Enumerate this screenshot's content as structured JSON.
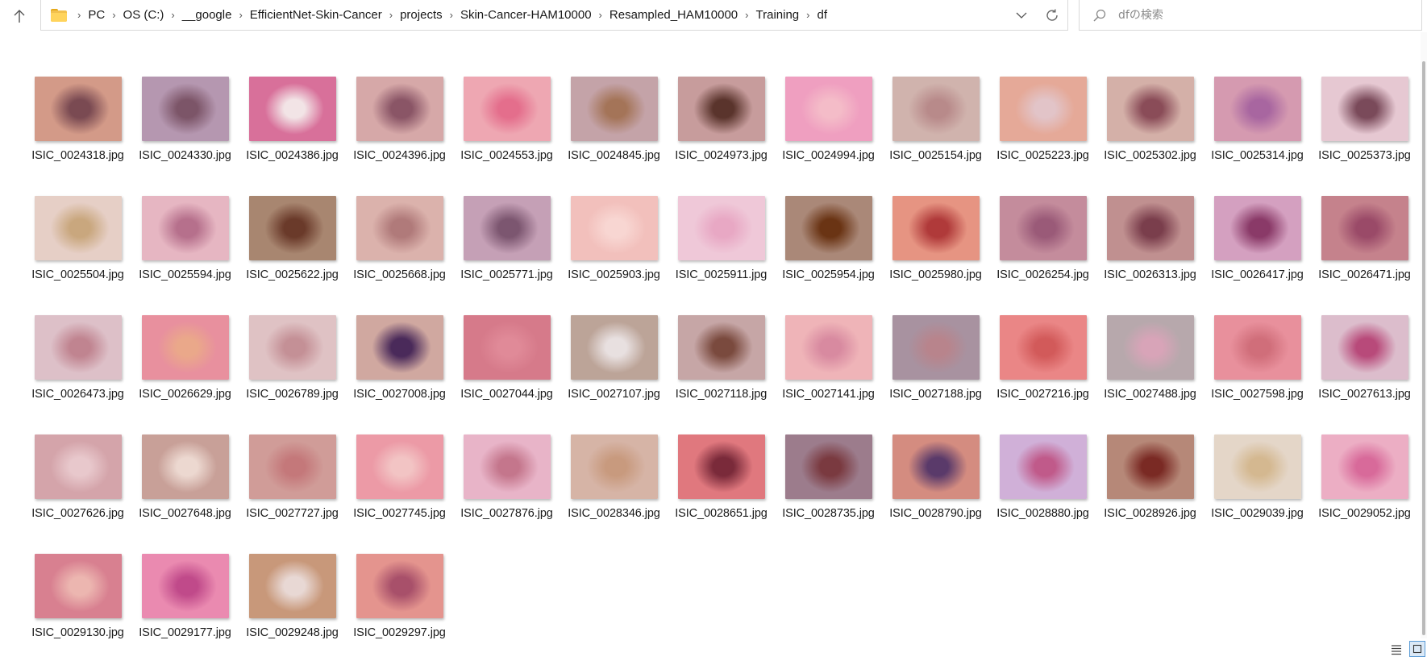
{
  "breadcrumb": {
    "items": [
      "PC",
      "OS (C:)",
      "__google",
      "EfficientNet-Skin-Cancer",
      "projects",
      "Skin-Cancer-HAM10000",
      "Resampled_HAM10000",
      "Training",
      "df"
    ]
  },
  "search": {
    "placeholder": "dfの検索"
  },
  "icons": {
    "up": "arrow-up-icon",
    "folder": "folder-icon",
    "dropdown": "chevron-down-icon",
    "refresh": "refresh-icon",
    "search": "search-icon",
    "details_view": "details-view-icon",
    "tiles_view": "large-icons-view-icon"
  },
  "files": [
    {
      "name": "ISIC_0024318.jpg",
      "bg": "#d39a88",
      "lesion": "#7a4a52"
    },
    {
      "name": "ISIC_0024330.jpg",
      "bg": "#b597b0",
      "lesion": "#7c5568"
    },
    {
      "name": "ISIC_0024386.jpg",
      "bg": "#d8709a",
      "lesion": "#f2e4e6"
    },
    {
      "name": "ISIC_0024396.jpg",
      "bg": "#d6a8a8",
      "lesion": "#8a5566"
    },
    {
      "name": "ISIC_0024553.jpg",
      "bg": "#eea7b2",
      "lesion": "#e46e8c"
    },
    {
      "name": "ISIC_0024845.jpg",
      "bg": "#c4a3a8",
      "lesion": "#a47458"
    },
    {
      "name": "ISIC_0024973.jpg",
      "bg": "#c79c9c",
      "lesion": "#5a342c"
    },
    {
      "name": "ISIC_0024994.jpg",
      "bg": "#ef9fc0",
      "lesion": "#f4bcc8"
    },
    {
      "name": "ISIC_0025154.jpg",
      "bg": "#d0b3ad",
      "lesion": "#b88a8a"
    },
    {
      "name": "ISIC_0025223.jpg",
      "bg": "#e5a998",
      "lesion": "#e2c4c8"
    },
    {
      "name": "ISIC_0025302.jpg",
      "bg": "#d4b0a8",
      "lesion": "#8a4c58"
    },
    {
      "name": "ISIC_0025314.jpg",
      "bg": "#d59ab0",
      "lesion": "#a866a0"
    },
    {
      "name": "ISIC_0025373.jpg",
      "bg": "#e6c8d2",
      "lesion": "#7a4a5a"
    },
    {
      "name": "ISIC_0025504.jpg",
      "bg": "#e6cfc6",
      "lesion": "#c9a77e"
    },
    {
      "name": "ISIC_0025594.jpg",
      "bg": "#e6b6c2",
      "lesion": "#b6708c"
    },
    {
      "name": "ISIC_0025622.jpg",
      "bg": "#a88670",
      "lesion": "#6a3a2a"
    },
    {
      "name": "ISIC_0025668.jpg",
      "bg": "#dbb2ac",
      "lesion": "#b07a7a"
    },
    {
      "name": "ISIC_0025771.jpg",
      "bg": "#c5a0b6",
      "lesion": "#7c5670"
    },
    {
      "name": "ISIC_0025903.jpg",
      "bg": "#f2c0bc",
      "lesion": "#f8d6d2"
    },
    {
      "name": "ISIC_0025911.jpg",
      "bg": "#efc8d8",
      "lesion": "#e8a8c4"
    },
    {
      "name": "ISIC_0025954.jpg",
      "bg": "#aa8878",
      "lesion": "#6a3414"
    },
    {
      "name": "ISIC_0025980.jpg",
      "bg": "#e69482",
      "lesion": "#b03a3a"
    },
    {
      "name": "ISIC_0026254.jpg",
      "bg": "#c48c9c",
      "lesion": "#9a5a78"
    },
    {
      "name": "ISIC_0026313.jpg",
      "bg": "#c09090",
      "lesion": "#7a3e4c"
    },
    {
      "name": "ISIC_0026417.jpg",
      "bg": "#d4a0c0",
      "lesion": "#8a3a68"
    },
    {
      "name": "ISIC_0026471.jpg",
      "bg": "#c5828c",
      "lesion": "#9a4a68"
    },
    {
      "name": "ISIC_0026473.jpg",
      "bg": "#ddc0c8",
      "lesion": "#c08490"
    },
    {
      "name": "ISIC_0026629.jpg",
      "bg": "#e8909e",
      "lesion": "#eaa88a"
    },
    {
      "name": "ISIC_0026789.jpg",
      "bg": "#dfc2c4",
      "lesion": "#c49096"
    },
    {
      "name": "ISIC_0027008.jpg",
      "bg": "#d0a8a0",
      "lesion": "#4a2a5a"
    },
    {
      "name": "ISIC_0027044.jpg",
      "bg": "#d67a8a",
      "lesion": "#e08a98"
    },
    {
      "name": "ISIC_0027107.jpg",
      "bg": "#bca498",
      "lesion": "#e8e0e0"
    },
    {
      "name": "ISIC_0027118.jpg",
      "bg": "#c6a6a6",
      "lesion": "#7a4a3e"
    },
    {
      "name": "ISIC_0027141.jpg",
      "bg": "#efb4b8",
      "lesion": "#d88aa0"
    },
    {
      "name": "ISIC_0027188.jpg",
      "bg": "#a892a0",
      "lesion": "#b8848c"
    },
    {
      "name": "ISIC_0027216.jpg",
      "bg": "#ea8686",
      "lesion": "#d25a5a"
    },
    {
      "name": "ISIC_0027488.jpg",
      "bg": "#b7a8ac",
      "lesion": "#d8a4b8"
    },
    {
      "name": "ISIC_0027598.jpg",
      "bg": "#e8909c",
      "lesion": "#d06e7a"
    },
    {
      "name": "ISIC_0027613.jpg",
      "bg": "#dcbdcc",
      "lesion": "#b84a7a"
    },
    {
      "name": "ISIC_0027626.jpg",
      "bg": "#d4a4aa",
      "lesion": "#e8c8cc"
    },
    {
      "name": "ISIC_0027648.jpg",
      "bg": "#c8a098",
      "lesion": "#ecd8d0"
    },
    {
      "name": "ISIC_0027727.jpg",
      "bg": "#d09c98",
      "lesion": "#c4787a"
    },
    {
      "name": "ISIC_0027745.jpg",
      "bg": "#ec9aa6",
      "lesion": "#f2c4c4"
    },
    {
      "name": "ISIC_0027876.jpg",
      "bg": "#e8b4c8",
      "lesion": "#c4768c"
    },
    {
      "name": "ISIC_0028346.jpg",
      "bg": "#d6b4a6",
      "lesion": "#c89a7e"
    },
    {
      "name": "ISIC_0028651.jpg",
      "bg": "#e0787e",
      "lesion": "#7a2a3a"
    },
    {
      "name": "ISIC_0028735.jpg",
      "bg": "#9c7c8c",
      "lesion": "#7a3a40"
    },
    {
      "name": "ISIC_0028790.jpg",
      "bg": "#d48c80",
      "lesion": "#5a3a6a"
    },
    {
      "name": "ISIC_0028880.jpg",
      "bg": "#d0b0d8",
      "lesion": "#c05a8a"
    },
    {
      "name": "ISIC_0028926.jpg",
      "bg": "#b68878",
      "lesion": "#7a2a24"
    },
    {
      "name": "ISIC_0029039.jpg",
      "bg": "#e4d6c8",
      "lesion": "#d4b890"
    },
    {
      "name": "ISIC_0029052.jpg",
      "bg": "#ecaec4",
      "lesion": "#d86a9a"
    },
    {
      "name": "ISIC_0029130.jpg",
      "bg": "#d88090",
      "lesion": "#ecb6b0"
    },
    {
      "name": "ISIC_0029177.jpg",
      "bg": "#ea8ab0",
      "lesion": "#c04a8a"
    },
    {
      "name": "ISIC_0029248.jpg",
      "bg": "#c8987a",
      "lesion": "#e8d8d4"
    },
    {
      "name": "ISIC_0029297.jpg",
      "bg": "#e4948e",
      "lesion": "#a8506a"
    }
  ]
}
